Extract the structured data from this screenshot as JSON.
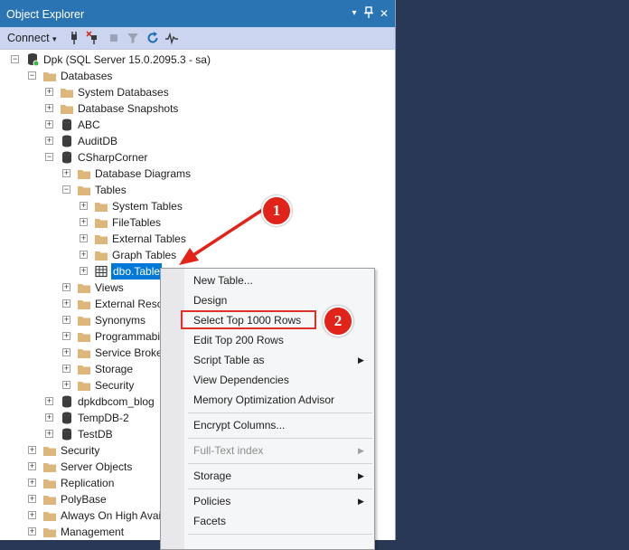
{
  "window": {
    "title": "Object Explorer",
    "pin_glyph": "▙",
    "close_glyph": "✕",
    "dropdown_glyph": "▾"
  },
  "toolbar": {
    "connect_label": "Connect",
    "connect_caret": "▾"
  },
  "tree": {
    "server": "Dpk (SQL Server 15.0.2095.3 - sa)",
    "databases": "Databases",
    "system_databases": "System Databases",
    "database_snapshots": "Database Snapshots",
    "abc": "ABC",
    "auditdb": "AuditDB",
    "csharpcorner": "CSharpCorner",
    "database_diagrams": "Database Diagrams",
    "tables": "Tables",
    "system_tables": "System Tables",
    "filetables": "FileTables",
    "external_tables": "External Tables",
    "graph_tables": "Graph Tables",
    "dbo_table": "dbo.Table",
    "views": "Views",
    "external_resources": "External Resou",
    "synonyms": "Synonyms",
    "programmability": "Programmabi",
    "service_broker": "Service Broker",
    "storage": "Storage",
    "security_db": "Security",
    "dpkdbcom_blog": "dpkdbcom_blog",
    "tempdb2": "TempDB-2",
    "testdb": "TestDB",
    "security": "Security",
    "server_objects": "Server Objects",
    "replication": "Replication",
    "polybase": "PolyBase",
    "always_on": "Always On High Avai",
    "management": "Management"
  },
  "context_menu": {
    "new_table": "New Table...",
    "design": "Design",
    "select_top": "Select Top 1000 Rows",
    "edit_top": "Edit Top 200 Rows",
    "script_table_as": "Script Table as",
    "view_dependencies": "View Dependencies",
    "memory_optimization": "Memory Optimization Advisor",
    "encrypt_columns": "Encrypt Columns...",
    "full_text_index": "Full-Text index",
    "storage": "Storage",
    "policies": "Policies",
    "facets": "Facets"
  },
  "annotations": {
    "step1": "1",
    "step2": "2"
  },
  "colors": {
    "accent_red": "#e2231a",
    "selection_blue": "#0078d7",
    "titlebar_blue": "#2a74b3",
    "background": "#293955"
  }
}
